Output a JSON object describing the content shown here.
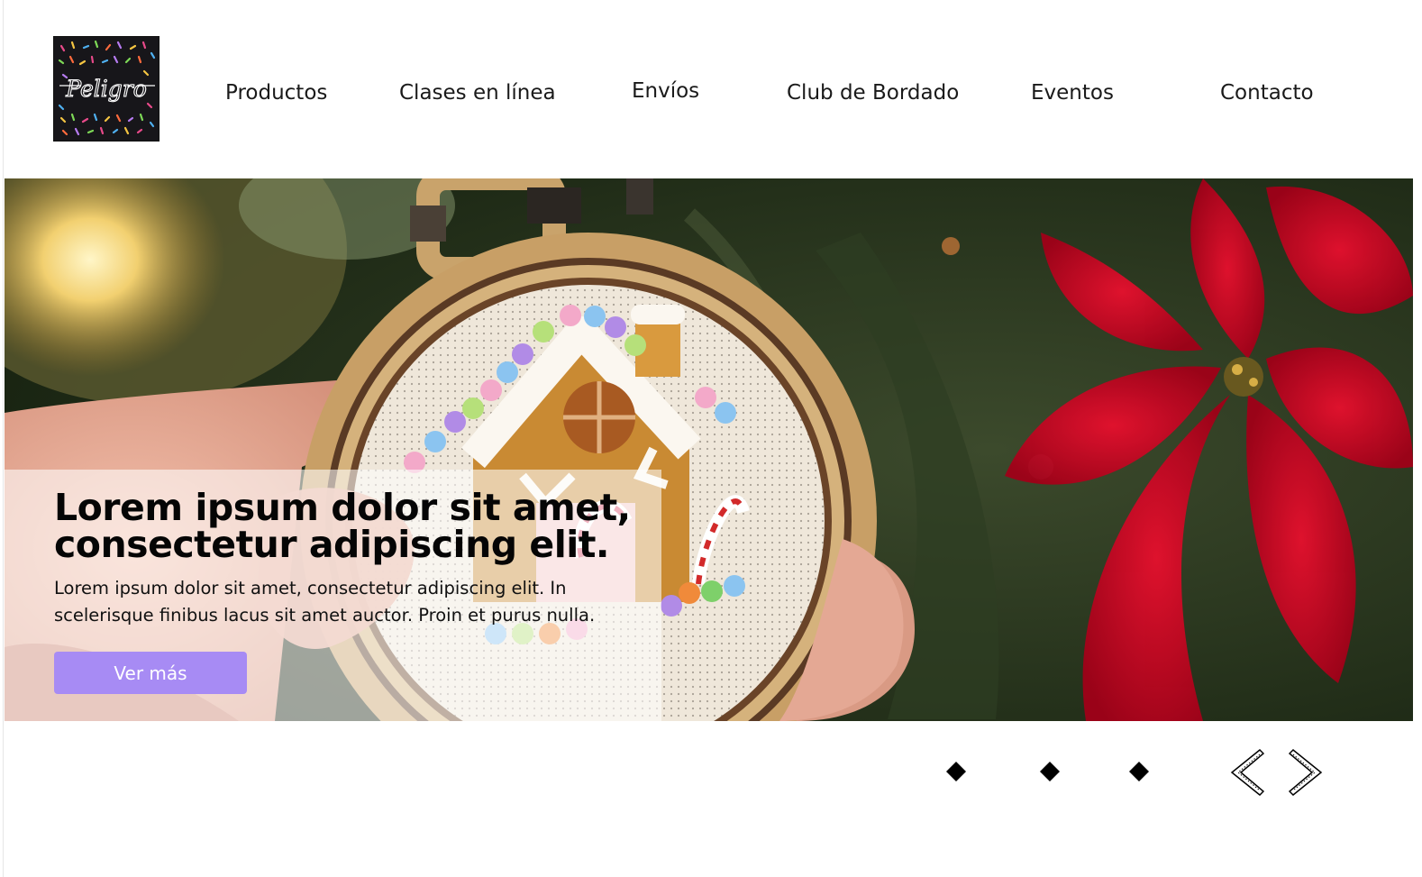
{
  "brand": {
    "logo_text": "Peligro",
    "logo_background": "#17161a"
  },
  "nav": {
    "items": [
      {
        "label": "Productos"
      },
      {
        "label": "Clases en línea"
      },
      {
        "label": "Envíos"
      },
      {
        "label": "Club de Bordado"
      },
      {
        "label": "Eventos"
      },
      {
        "label": "Contacto"
      }
    ]
  },
  "hero": {
    "image": "embroidery-hoop-gingerbread-house-photo",
    "title": "Lorem ipsum dolor sit amet, consectetur adipiscing elit.",
    "text": "Lorem ipsum dolor sit amet, consectetur adipiscing elit. In scelerisque finibus lacus sit amet auctor. Proin et purus nulla.",
    "button_label": "Ver más",
    "button_color": "#a78bf4"
  },
  "carousel": {
    "dots": 3,
    "prev_icon": "chevron-left-icon",
    "next_icon": "chevron-right-icon"
  }
}
